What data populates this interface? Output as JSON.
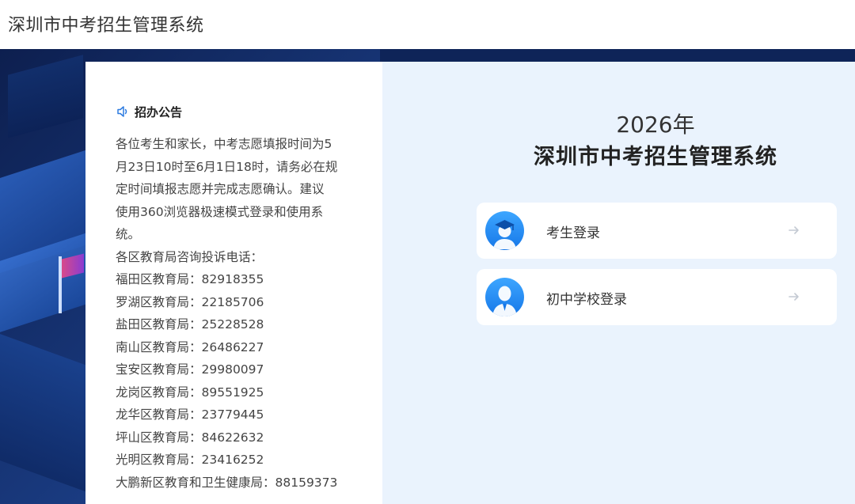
{
  "header": {
    "title": "深圳市中考招生管理系统"
  },
  "notice": {
    "heading": "招办公告",
    "lines": [
      "各位考生和家长，中考志愿填报时间为5",
      "月23日10时至6月1日18时，请务必在规",
      "定时间填报志愿并完成志愿确认。建议",
      "使用360浏览器极速模式登录和使用系",
      "统。",
      "各区教育局咨询投诉电话：",
      "福田区教育局：82918355",
      "罗湖区教育局：22185706",
      "盐田区教育局：25228528",
      "南山区教育局：26486227",
      "宝安区教育局：29980097",
      "龙岗区教育局：89551925",
      "龙华区教育局：23779445",
      "坪山区教育局：84622632",
      "光明区教育局：23416252",
      "大鹏新区教育和卫生健康局：88159373"
    ]
  },
  "main": {
    "year": "2026年",
    "system_title": "深圳市中考招生管理系统",
    "logins": [
      {
        "label": "考生登录",
        "icon": "graduate-avatar-icon"
      },
      {
        "label": "初中学校登录",
        "icon": "teacher-avatar-icon"
      }
    ]
  },
  "colors": {
    "accent": "#1677e8",
    "panel_bg": "#eaf3fd",
    "background": "#1b3e86"
  }
}
